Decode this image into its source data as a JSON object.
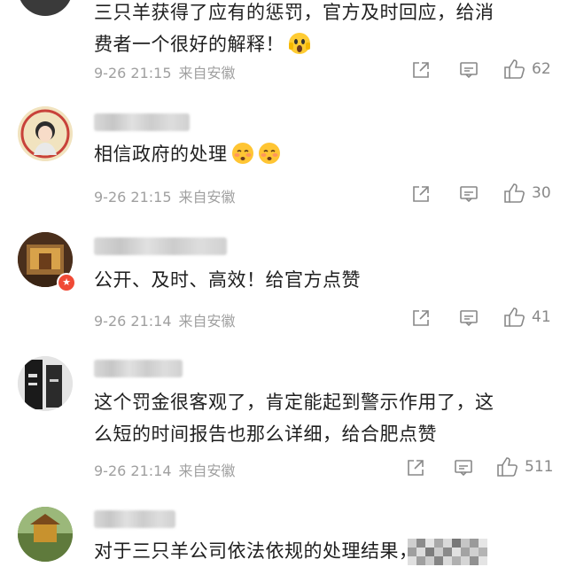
{
  "comments": [
    {
      "id": "c0",
      "text_line1": "三只羊获得了应有的惩罚，官方及时回应，给消",
      "text_line2": "费者一个很好的解释！",
      "emoji": "scream-face-emoji",
      "time": "9-26 21:15",
      "source": "来自安徽",
      "likes": "62"
    },
    {
      "id": "c1",
      "text": "相信政府的处理",
      "emojis": [
        "blushing-face-emoji",
        "blushing-face-emoji"
      ],
      "time": "9-26 21:15",
      "source": "来自安徽",
      "likes": "30"
    },
    {
      "id": "c2",
      "text": "公开、及时、高效！给官方点赞",
      "time": "9-26 21:14",
      "source": "来自安徽",
      "likes": "41",
      "badge": "★"
    },
    {
      "id": "c3",
      "text_line1": "这个罚金很客观了，肯定能起到警示作用了，这",
      "text_line2": "么短的时间报告也那么详细，给合肥点赞",
      "time": "9-26 21:14",
      "source": "来自安徽",
      "likes": "511"
    },
    {
      "id": "c4",
      "text": "对于三只羊公司依法依规的处理结果，我们支"
    }
  ],
  "icons": {
    "share": "share-icon",
    "reply": "comment-icon",
    "like": "thumbs-up-icon"
  },
  "colors": {
    "text": "#1f1f1f",
    "meta": "#a0a0a0",
    "icon": "#888888",
    "badge": "#f04a36"
  }
}
